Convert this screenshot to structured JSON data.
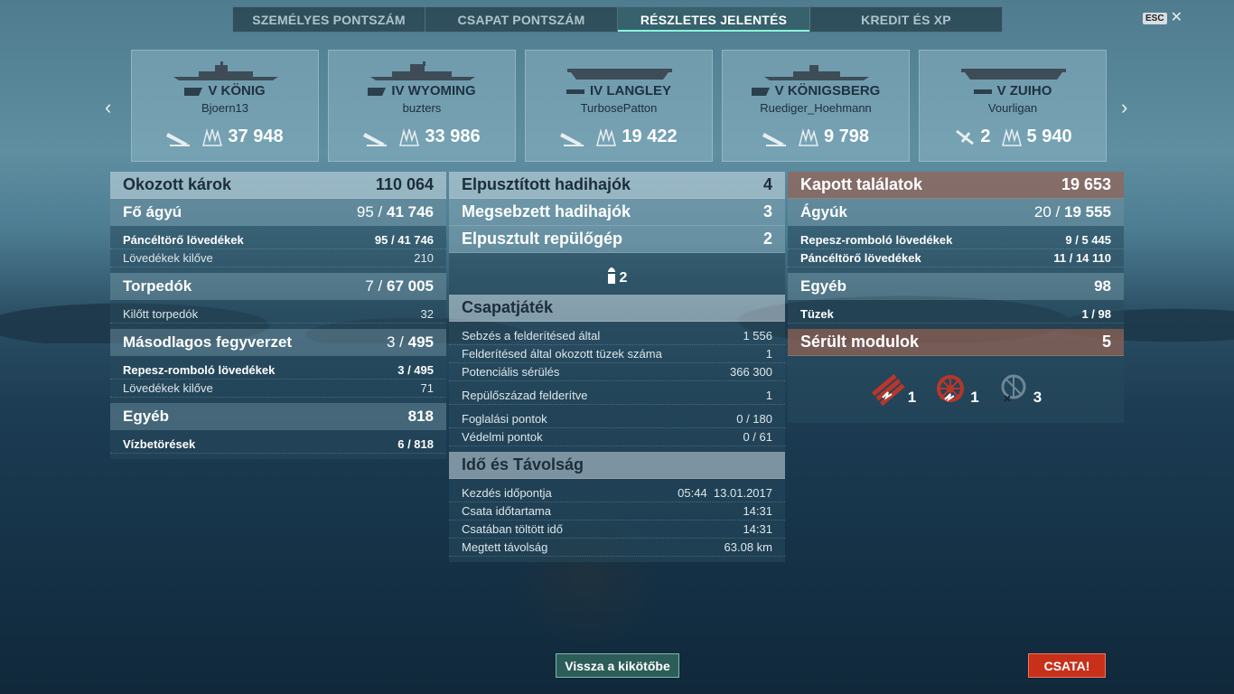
{
  "tabs": [
    {
      "label": "SZEMÉLYES PONTSZÁM",
      "active": false
    },
    {
      "label": "CSAPAT PONTSZÁM",
      "active": false
    },
    {
      "label": "RÉSZLETES JELENTÉS",
      "active": true
    },
    {
      "label": "KREDIT ÉS XP",
      "active": false
    }
  ],
  "esc_label": "ESC",
  "ships": [
    {
      "name": "V KÖNIG",
      "player": "Bjoern13",
      "type": "battleship-icon",
      "kills": null,
      "damage": "37 948"
    },
    {
      "name": "IV WYOMING",
      "player": "buzters",
      "type": "battleship-icon",
      "kills": null,
      "damage": "33 986"
    },
    {
      "name": "IV LANGLEY",
      "player": "TurbosePatton",
      "type": "carrier-icon",
      "kills": null,
      "damage": "19 422"
    },
    {
      "name": "V KÖNIGSBERG",
      "player": "Ruediger_Hoehmann",
      "type": "cruiser-icon",
      "kills": null,
      "damage": "9 798"
    },
    {
      "name": "V ZUIHO",
      "player": "Vourligan",
      "type": "carrier-icon",
      "kills": "2",
      "damage": "5 940"
    }
  ],
  "left": {
    "title": "Okozott károk",
    "total": "110 064",
    "main": {
      "label": "Fő ágyú",
      "hits": "95",
      "val": "41 746",
      "rows": [
        {
          "label": "Páncéltörő lövedékek",
          "hits": "95",
          "val": "41 746",
          "bold": true
        },
        {
          "label": "Lövedékek kilőve",
          "value": "210"
        }
      ]
    },
    "torp": {
      "label": "Torpedók",
      "hits": "7",
      "val": "67 005",
      "rows": [
        {
          "label": "Kilőtt torpedók",
          "value": "32"
        }
      ]
    },
    "sec": {
      "label": "Másodlagos fegyverzet",
      "hits": "3",
      "val": "495",
      "rows": [
        {
          "label": "Repesz-romboló lövedékek",
          "hits": "3",
          "val": "495",
          "bold": true
        },
        {
          "label": "Lövedékek kilőve",
          "value": "71"
        }
      ]
    },
    "other": {
      "label": "Egyéb",
      "value": "818",
      "rows": [
        {
          "label": "Vízbetörések",
          "hits": "6",
          "val": "818",
          "bold": true
        }
      ]
    }
  },
  "mid": {
    "destroyed": {
      "label": "Elpusztított hadihajók",
      "value": "4"
    },
    "damaged": {
      "label": "Megsebzett hadihajók",
      "value": "3"
    },
    "planes": {
      "label": "Elpusztult repülőgép",
      "value": "2"
    },
    "ribbon_count": "2",
    "team": {
      "title": "Csapatjáték",
      "rows": [
        {
          "label": "Sebzés a felderítésed által",
          "value": "1 556"
        },
        {
          "label": "Felderítésed által okozott tüzek száma",
          "value": "1"
        },
        {
          "label": "Potenciális sérülés",
          "value": "366 300"
        },
        {
          "label": "Repülőszázad felderítve",
          "value": "1"
        },
        {
          "label": "Foglalási pontok",
          "value": "0 / 180"
        },
        {
          "label": "Védelmi pontok",
          "value": "0 / 61"
        }
      ]
    },
    "time": {
      "title": "Idő és Távolság",
      "rows": [
        {
          "label": "Kezdés időpontja",
          "value": "05:44  13.01.2017"
        },
        {
          "label": "Csata időtartama",
          "value": "14:31"
        },
        {
          "label": "Csatában töltött idő",
          "value": "14:31"
        },
        {
          "label": "Megtett távolság",
          "value": "63.08 km"
        }
      ]
    }
  },
  "right": {
    "title": "Kapott találatok",
    "total": "19 653",
    "guns": {
      "label": "Ágyúk",
      "hits": "20",
      "val": "19 555",
      "rows": [
        {
          "label": "Repesz-romboló lövedékek",
          "hits": "9",
          "val": "5 445"
        },
        {
          "label": "Páncéltörő lövedékek",
          "hits": "11",
          "val": "14 110"
        }
      ]
    },
    "other": {
      "label": "Egyéb",
      "value": "98",
      "rows": [
        {
          "label": "Tüzek",
          "hits": "1",
          "val": "98"
        }
      ]
    },
    "modules": {
      "label": "Sérült modulok",
      "value": "5",
      "items": [
        {
          "icon": "torpedo-tubes-icon",
          "count": "1"
        },
        {
          "icon": "steering-gear-icon",
          "count": "1"
        },
        {
          "icon": "aa-gun-icon",
          "count": "3"
        }
      ]
    }
  },
  "buttons": {
    "port": "Vissza a kikötőbe",
    "battle": "CSATA!"
  },
  "colors": {
    "accent": "#8fd",
    "battle": "#c8301a",
    "received_header": "#96645580"
  }
}
